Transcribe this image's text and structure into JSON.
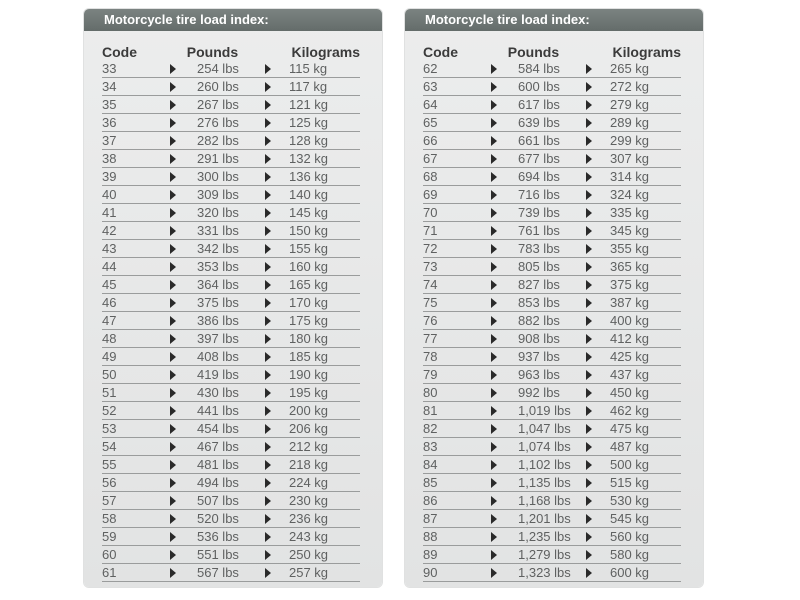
{
  "tables": [
    {
      "title": "Motorcycle tire load index:",
      "headers": {
        "code": "Code",
        "pounds": "Pounds",
        "kilograms": "Kilograms"
      },
      "rows": [
        {
          "code": "33",
          "lbs": "254 lbs",
          "kg": "115 kg"
        },
        {
          "code": "34",
          "lbs": "260 lbs",
          "kg": "117 kg"
        },
        {
          "code": "35",
          "lbs": "267 lbs",
          "kg": "121 kg"
        },
        {
          "code": "36",
          "lbs": "276 lbs",
          "kg": "125 kg"
        },
        {
          "code": "37",
          "lbs": "282 lbs",
          "kg": "128 kg"
        },
        {
          "code": "38",
          "lbs": "291 lbs",
          "kg": "132 kg"
        },
        {
          "code": "39",
          "lbs": "300 lbs",
          "kg": "136 kg"
        },
        {
          "code": "40",
          "lbs": "309 lbs",
          "kg": "140 kg"
        },
        {
          "code": "41",
          "lbs": "320 lbs",
          "kg": "145 kg"
        },
        {
          "code": "42",
          "lbs": "331 lbs",
          "kg": "150 kg"
        },
        {
          "code": "43",
          "lbs": "342 lbs",
          "kg": "155 kg"
        },
        {
          "code": "44",
          "lbs": "353 lbs",
          "kg": "160 kg"
        },
        {
          "code": "45",
          "lbs": "364 lbs",
          "kg": "165 kg"
        },
        {
          "code": "46",
          "lbs": "375 lbs",
          "kg": "170 kg"
        },
        {
          "code": "47",
          "lbs": "386 lbs",
          "kg": "175 kg"
        },
        {
          "code": "48",
          "lbs": "397 lbs",
          "kg": "180 kg"
        },
        {
          "code": "49",
          "lbs": "408 lbs",
          "kg": "185 kg"
        },
        {
          "code": "50",
          "lbs": "419 lbs",
          "kg": "190 kg"
        },
        {
          "code": "51",
          "lbs": "430 lbs",
          "kg": "195 kg"
        },
        {
          "code": "52",
          "lbs": "441 lbs",
          "kg": "200 kg"
        },
        {
          "code": "53",
          "lbs": "454 lbs",
          "kg": "206 kg"
        },
        {
          "code": "54",
          "lbs": "467 lbs",
          "kg": "212 kg"
        },
        {
          "code": "55",
          "lbs": "481 lbs",
          "kg": "218 kg"
        },
        {
          "code": "56",
          "lbs": "494 lbs",
          "kg": "224 kg"
        },
        {
          "code": "57",
          "lbs": "507 lbs",
          "kg": "230 kg"
        },
        {
          "code": "58",
          "lbs": "520 lbs",
          "kg": "236 kg"
        },
        {
          "code": "59",
          "lbs": "536 lbs",
          "kg": "243 kg"
        },
        {
          "code": "60",
          "lbs": "551 lbs",
          "kg": "250 kg"
        },
        {
          "code": "61",
          "lbs": "567 lbs",
          "kg": "257 kg"
        }
      ]
    },
    {
      "title": "Motorcycle tire load index:",
      "headers": {
        "code": "Code",
        "pounds": "Pounds",
        "kilograms": "Kilograms"
      },
      "rows": [
        {
          "code": "62",
          "lbs": "584 lbs",
          "kg": "265 kg"
        },
        {
          "code": "63",
          "lbs": "600 lbs",
          "kg": "272 kg"
        },
        {
          "code": "64",
          "lbs": "617 lbs",
          "kg": "279 kg"
        },
        {
          "code": "65",
          "lbs": "639 lbs",
          "kg": "289 kg"
        },
        {
          "code": "66",
          "lbs": "661 lbs",
          "kg": "299 kg"
        },
        {
          "code": "67",
          "lbs": "677 lbs",
          "kg": "307 kg"
        },
        {
          "code": "68",
          "lbs": "694 lbs",
          "kg": "314 kg"
        },
        {
          "code": "69",
          "lbs": "716 lbs",
          "kg": "324 kg"
        },
        {
          "code": "70",
          "lbs": "739 lbs",
          "kg": "335 kg"
        },
        {
          "code": "71",
          "lbs": "761 lbs",
          "kg": "345 kg"
        },
        {
          "code": "72",
          "lbs": "783 lbs",
          "kg": "355 kg"
        },
        {
          "code": "73",
          "lbs": "805 lbs",
          "kg": "365 kg"
        },
        {
          "code": "74",
          "lbs": "827 lbs",
          "kg": "375 kg"
        },
        {
          "code": "75",
          "lbs": "853 lbs",
          "kg": "387 kg"
        },
        {
          "code": "76",
          "lbs": "882 lbs",
          "kg": "400 kg"
        },
        {
          "code": "77",
          "lbs": "908 lbs",
          "kg": "412 kg"
        },
        {
          "code": "78",
          "lbs": "937 lbs",
          "kg": "425 kg"
        },
        {
          "code": "79",
          "lbs": "963 lbs",
          "kg": "437 kg"
        },
        {
          "code": "80",
          "lbs": "992 lbs",
          "kg": "450 kg"
        },
        {
          "code": "81",
          "lbs": "1,019 lbs",
          "kg": "462 kg"
        },
        {
          "code": "82",
          "lbs": "1,047 lbs",
          "kg": "475 kg"
        },
        {
          "code": "83",
          "lbs": "1,074 lbs",
          "kg": "487 kg"
        },
        {
          "code": "84",
          "lbs": "1,102 lbs",
          "kg": "500 kg"
        },
        {
          "code": "85",
          "lbs": "1,135 lbs",
          "kg": "515 kg"
        },
        {
          "code": "86",
          "lbs": "1,168 lbs",
          "kg": "530 kg"
        },
        {
          "code": "87",
          "lbs": "1,201 lbs",
          "kg": "545 kg"
        },
        {
          "code": "88",
          "lbs": "1,235 lbs",
          "kg": "560 kg"
        },
        {
          "code": "89",
          "lbs": "1,279 lbs",
          "kg": "580 kg"
        },
        {
          "code": "90",
          "lbs": "1,323 lbs",
          "kg": "600 kg"
        }
      ]
    }
  ],
  "icons": {
    "row_arrow": "triangle-right-icon"
  },
  "colors": {
    "header_bg": "#6e7674",
    "panel_bg": "#e8e9e9",
    "row_text": "#5f6161",
    "arrow": "#2a2a2a"
  }
}
